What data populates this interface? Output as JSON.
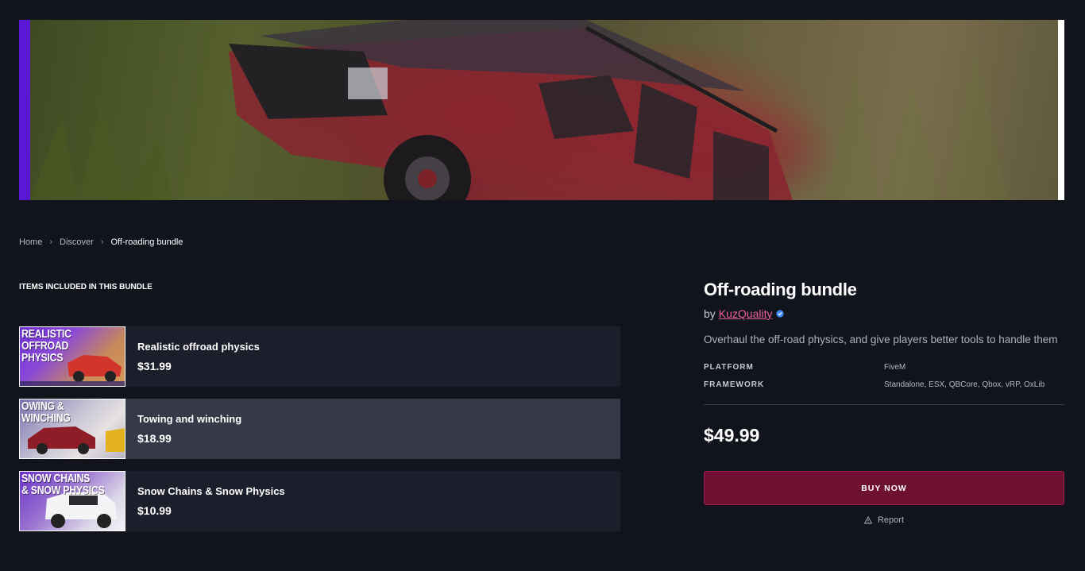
{
  "banner": {
    "image_name": "off-road-truck-banner",
    "accent_color": "#5a18d6"
  },
  "breadcrumb": {
    "items": [
      "Home",
      "Discover",
      "Off-roading bundle"
    ]
  },
  "bundle": {
    "heading": "ITEMS INCLUDED IN THIS BUNDLE",
    "items": [
      {
        "name": "Realistic offroad physics",
        "price": "$31.99",
        "thumb_title": "REALISTIC\nOFFROAD\nPHYSICS"
      },
      {
        "name": "Towing and winching",
        "price": "$18.99",
        "thumb_title": "OWING & WINCHING"
      },
      {
        "name": "Snow Chains & Snow Physics",
        "price": "$10.99",
        "thumb_title": "SNOW CHAINS\n& SNOW PHYSICS"
      }
    ]
  },
  "product": {
    "title": "Off-roading bundle",
    "by_label": "by",
    "author": "KuzQuality",
    "description": "Overhaul the off-road physics, and give players better tools to handle them",
    "specs": [
      {
        "key": "PLATFORM",
        "value": "FiveM"
      },
      {
        "key": "FRAMEWORK",
        "value": "Standalone, ESX, QBCore, Qbox, vRP, OxLib"
      }
    ],
    "price": "$49.99",
    "buy_label": "BUY NOW",
    "report_label": "Report"
  },
  "colors": {
    "background": "#12141d",
    "card": "#1c1f2b",
    "card_active": "#353948",
    "buy_button": "#6d1032",
    "author_link": "#ec5fa0",
    "verified": "#3d8bff"
  }
}
